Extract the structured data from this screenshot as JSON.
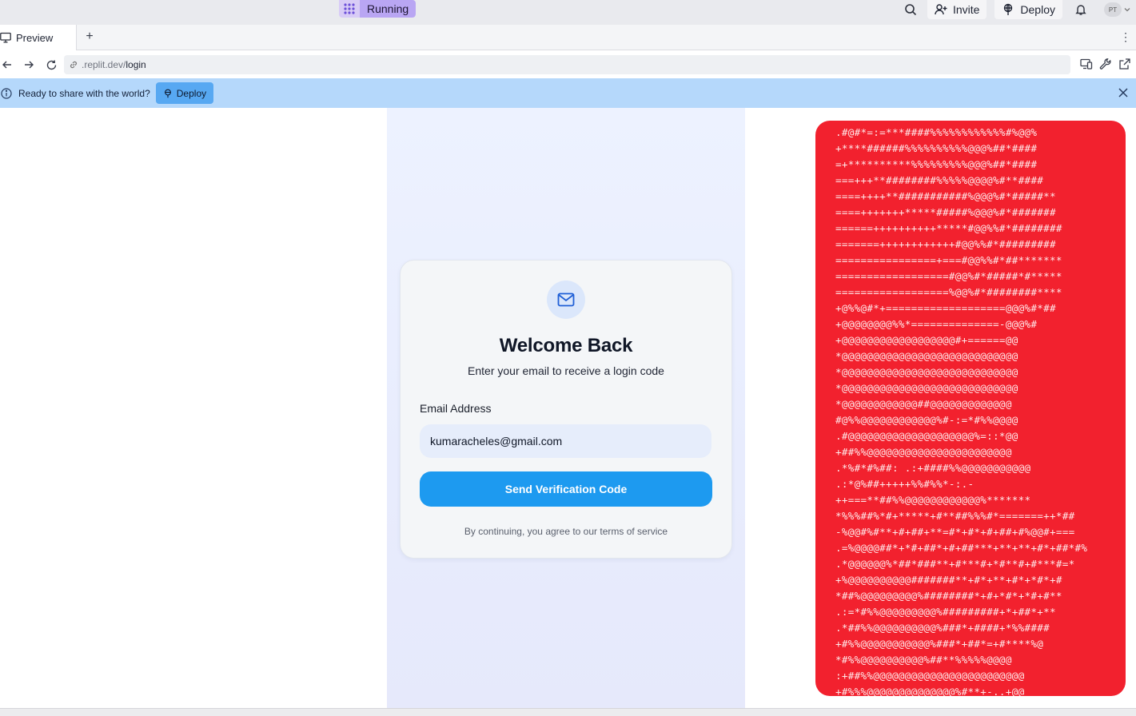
{
  "topbar": {
    "status_label": "Running",
    "invite_label": "Invite",
    "deploy_label": "Deploy",
    "avatar_initials": "PT",
    "icons": [
      "grid-icon",
      "search-icon",
      "add-user-icon",
      "deploy-icon",
      "bell-icon",
      "chevron-down-icon"
    ]
  },
  "tabs": {
    "active_label": "Preview",
    "add_label": "+",
    "more_label": "⋮"
  },
  "urlbar": {
    "host": ".replit.dev/",
    "path": "login"
  },
  "banner": {
    "message": "Ready to share with the world?",
    "deploy_label": "Deploy",
    "color": "#b5d8fb"
  },
  "login": {
    "title": "Welcome Back",
    "subtitle": "Enter your email to receive a login code",
    "email_label": "Email Address",
    "email_value": "kumaracheles@gmail.com",
    "button_label": "Send Verification Code",
    "terms": "By continuing, you agree to our terms of service",
    "accent": "#1d9af0"
  },
  "ascii_art": {
    "background": "#f2212e",
    "lines": [
      ".#@#*=:=***####%%%%%%%%%%%%#%@@%",
      "+****######%%%%%%%%%%@@@%##*####",
      "=+**********%%%%%%%%%@@@%##*####",
      "===+++**########%%%%%@@@@%#**####",
      "====++++**###########%@@@%#*#####**",
      "====+++++++*****#####%@@@%#*#######",
      "======++++++++++*****#@@%%#*########",
      "=======++++++++++++#@@%%#*#########",
      "================+===#@@%%#*##*******",
      "==================#@@%#*#####*#*****",
      "==================%@@%#*########****",
      "+@%%@#*+===================@@@%#*##",
      "+@@@@@@@@%%*==============-@@@%#",
      "+@@@@@@@@@@@@@@@@@@#+======@@",
      "*@@@@@@@@@@@@@@@@@@@@@@@@@@@@",
      "*@@@@@@@@@@@@@@@@@@@@@@@@@@@@",
      "*@@@@@@@@@@@@@@@@@@@@@@@@@@@@",
      "*@@@@@@@@@@@@##@@@@@@@@@@@@@",
      "#@%%@@@@@@@@@@@@%#-:=*#%%@@@@",
      ".#@@@@@@@@@@@@@@@@@@@@%=::*@@",
      "+##%%@@@@@@@@@@@@@@@@@@@@@@@",
      ".*%#*#%##: .:+####%%@@@@@@@@@@@",
      ".:*@%##+++++%%#%%*-:.-",
      "++===**##%%@@@@@@@@@@@@%*******",
      "*%%%##%*#+*****+#**##%%%#*=======++*##",
      "-%@@#%#**+#+##+**=#*+#*+#+##+#%@@#+===",
      ".=%@@@@##*+*#+##*+#+##***+**+**+#*+##*#%",
      ".*@@@@@@%*##*###**+#***#+*#**#+#***#=*",
      "+%@@@@@@@@@@#######**+#*+**+#*+*#*+#",
      "*##%@@@@@@@@@%########*+#+*#*+*#+#**",
      ".:=*#%%@@@@@@@@@%#########+*+##*+**",
      ".*##%%@@@@@@@@@@%###*+####+*%%####",
      "+#%%@@@@@@@@@@@%###*+##*=+#****%@",
      "*#%%@@@@@@@@@@%##**%%%%%@@@@",
      ":+##%%@@@@@@@@@@@@@@@@@@@@@@@@",
      "+#%%%@@@@@@@@@@@@@@%#**+-..+@@"
    ]
  }
}
